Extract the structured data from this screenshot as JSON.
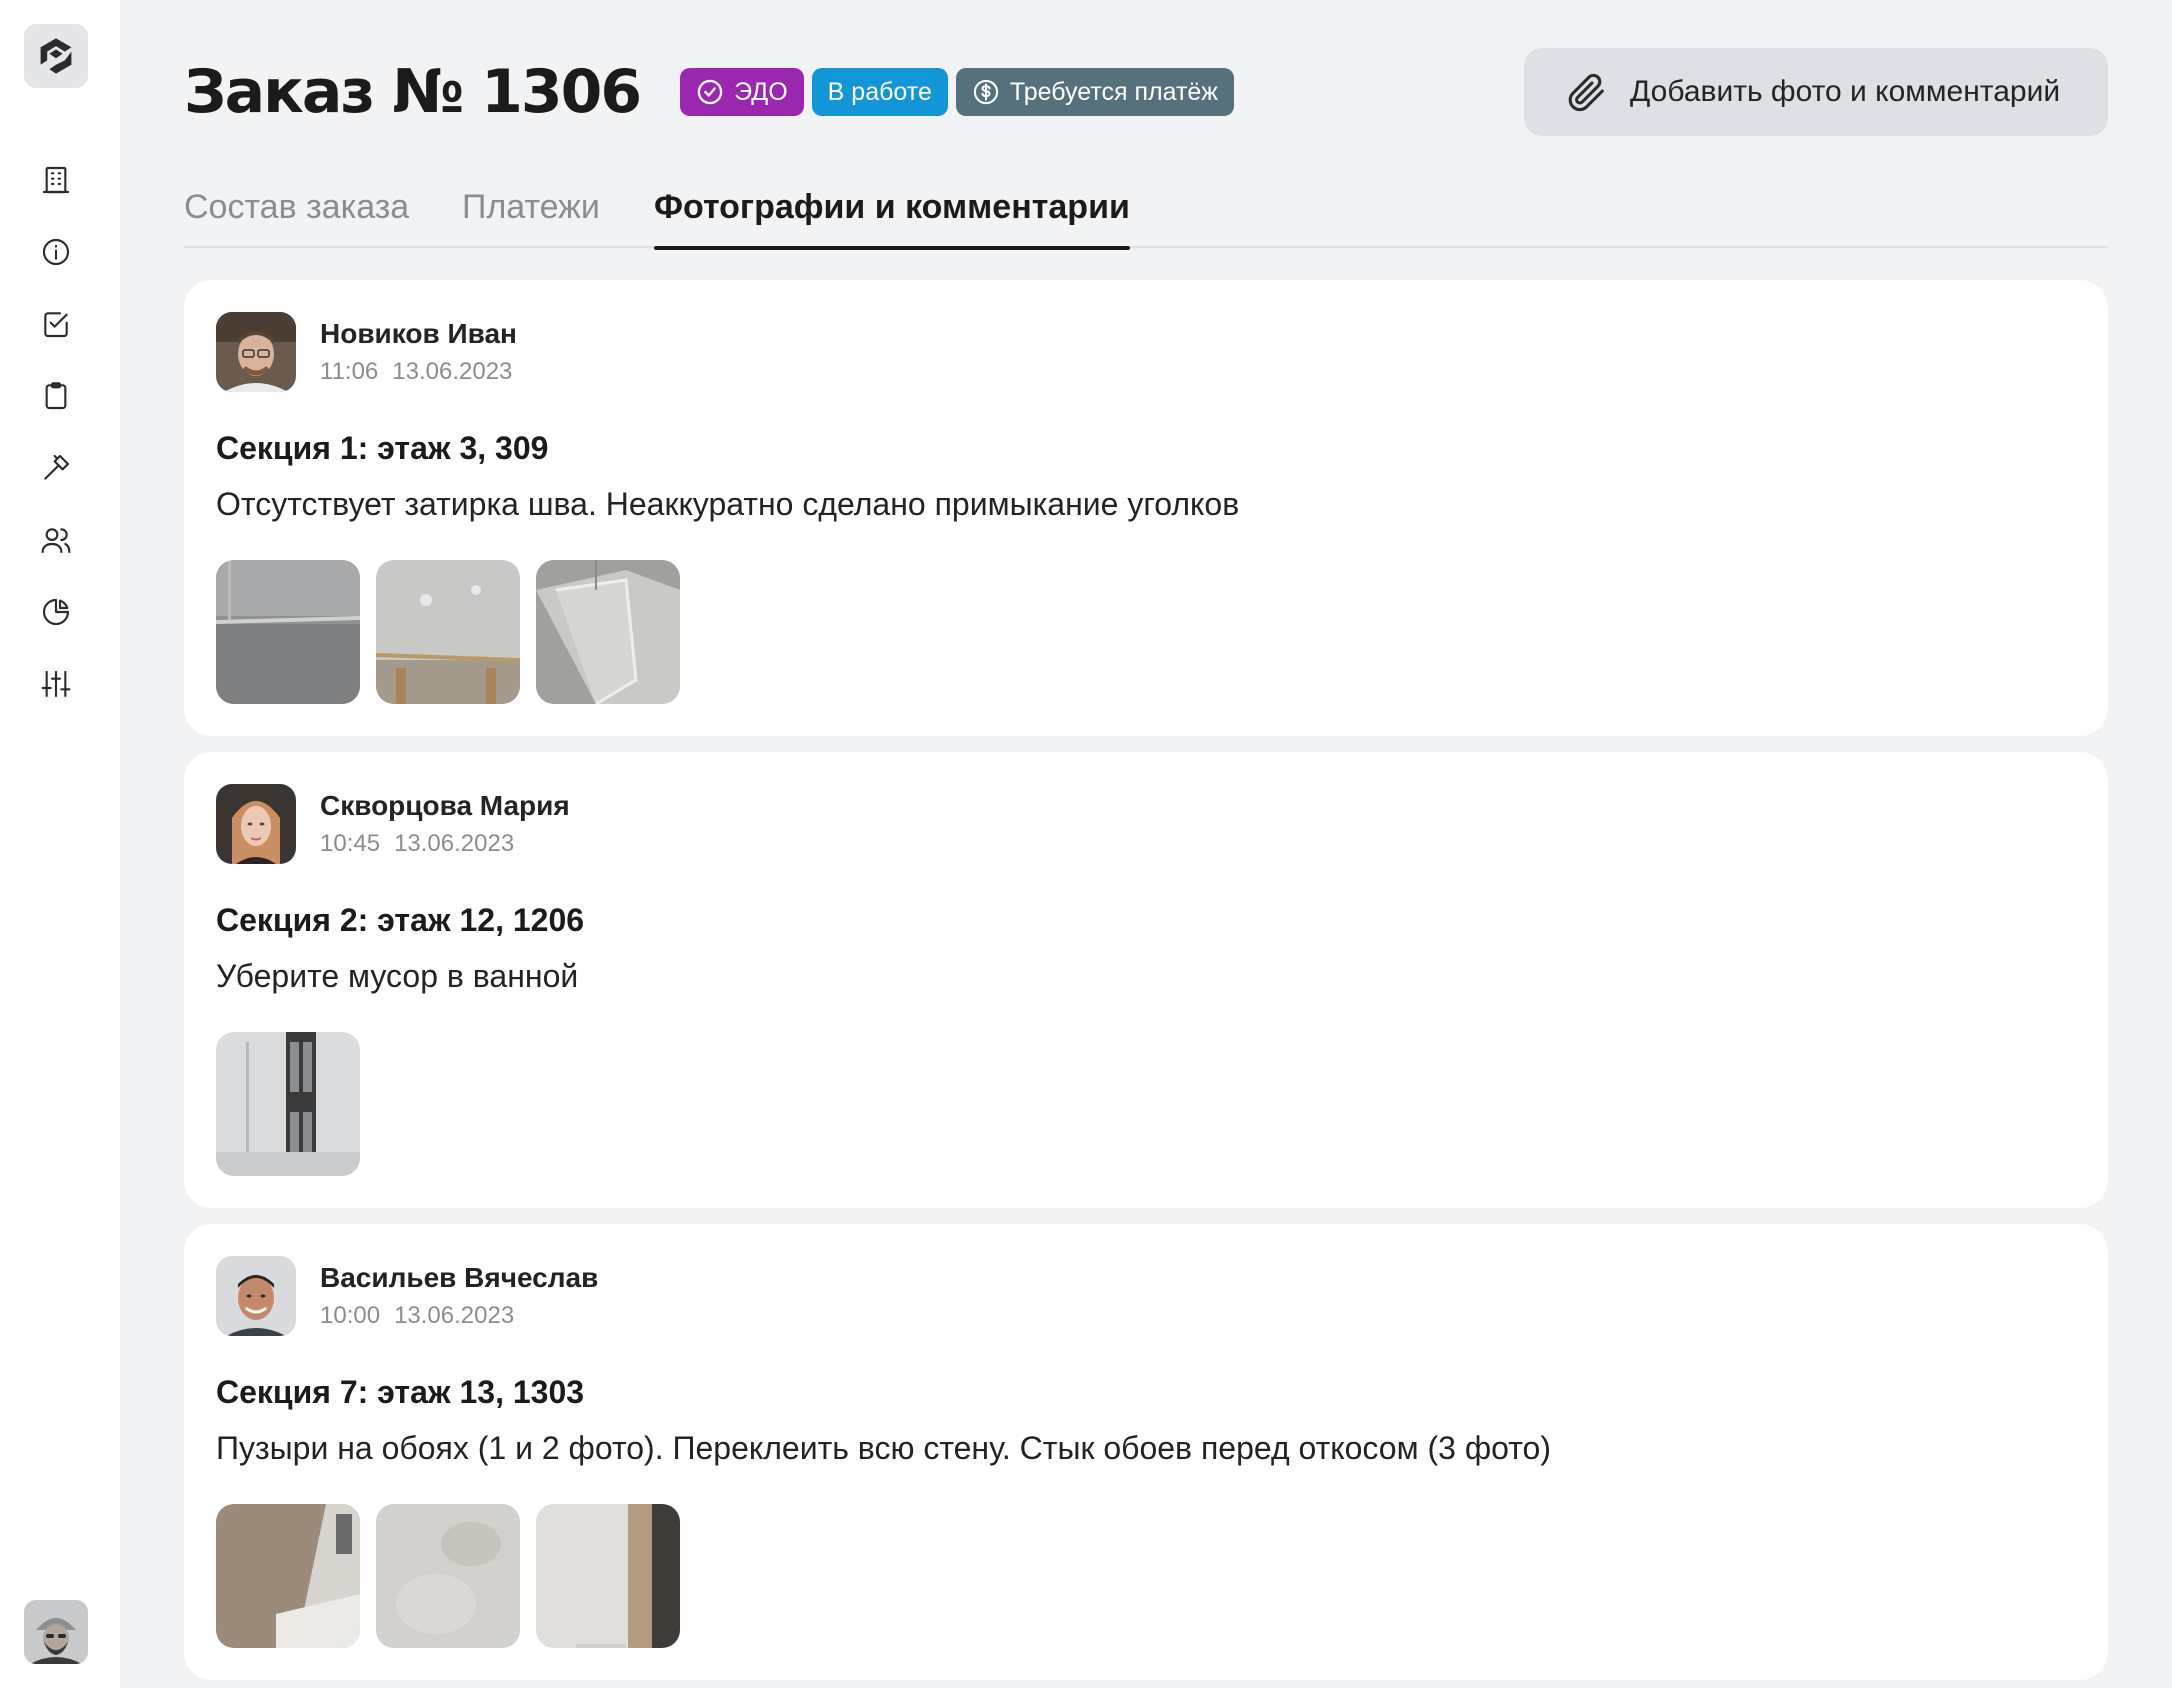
{
  "sidebar": {
    "icons": [
      "logo-icon",
      "building-icon",
      "info-icon",
      "task-check-icon",
      "clipboard-icon",
      "hammer-icon",
      "users-icon",
      "pie-chart-icon",
      "sliders-icon"
    ]
  },
  "header": {
    "title": "Заказ № 1306",
    "badges": {
      "edo": "ЭДО",
      "status": "В работе",
      "payment": "Требуется платёж"
    },
    "add_button": "Добавить фото и комментарий"
  },
  "colors": {
    "edo": "#9b27b0",
    "status": "#1296d8",
    "payment": "#56707c"
  },
  "tabs": [
    {
      "label": "Состав заказа",
      "active": false
    },
    {
      "label": "Платежи",
      "active": false
    },
    {
      "label": "Фотографии и комментарии",
      "active": true
    }
  ],
  "comments": [
    {
      "author": "Новиков Иван",
      "time": "11:06",
      "date": "13.06.2023",
      "section": "Секция 1: этаж 3, 309",
      "text": "Отсутствует затирка шва. Неаккуратно сделано примыкание уголков"
    },
    {
      "author": "Скворцова Мария",
      "time": "10:45",
      "date": "13.06.2023",
      "section": "Секция 2: этаж 12, 1206",
      "text": "Уберите мусор в ванной"
    },
    {
      "author": "Васильев Вячеслав",
      "time": "10:00",
      "date": "13.06.2023",
      "section": "Секция 7: этаж 13, 1303",
      "text": "Пузыри на обоях (1 и 2 фото). Переклеить всю стену. Стык обоев перед откосом (3 фото)"
    }
  ]
}
